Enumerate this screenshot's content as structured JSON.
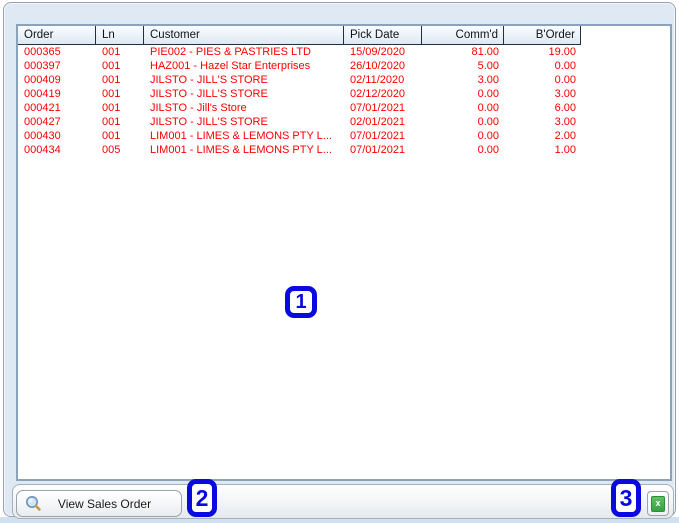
{
  "table": {
    "columns": [
      {
        "id": "order",
        "label": "Order"
      },
      {
        "id": "ln",
        "label": "Ln"
      },
      {
        "id": "customer",
        "label": "Customer"
      },
      {
        "id": "pickdate",
        "label": "Pick Date"
      },
      {
        "id": "commd",
        "label": "Comm'd"
      },
      {
        "id": "border",
        "label": "B'Order"
      }
    ],
    "rows": [
      [
        "000365",
        "001",
        "PIE002 - PIES & PASTRIES LTD",
        "15/09/2020",
        "81.00",
        "19.00"
      ],
      [
        "000397",
        "001",
        "HAZ001 - Hazel Star Enterprises",
        "26/10/2020",
        "5.00",
        "0.00"
      ],
      [
        "000409",
        "001",
        "JILSTO - JILL'S STORE",
        "02/11/2020",
        "3.00",
        "0.00"
      ],
      [
        "000419",
        "001",
        "JILSTO - JILL'S STORE",
        "02/12/2020",
        "0.00",
        "3.00"
      ],
      [
        "000421",
        "001",
        "JILSTO - Jill's Store",
        "07/01/2021",
        "0.00",
        "6.00"
      ],
      [
        "000427",
        "001",
        "JILSTO - JILL'S STORE",
        "02/01/2021",
        "0.00",
        "3.00"
      ],
      [
        "000430",
        "001",
        "LIM001 - LIMES & LEMONS PTY L...",
        "07/01/2021",
        "0.00",
        "2.00"
      ],
      [
        "000434",
        "005",
        "LIM001 - LIMES & LEMONS PTY L...",
        "07/01/2021",
        "0.00",
        "1.00"
      ]
    ],
    "row_text_color": "#ff0000"
  },
  "toolbar": {
    "view_sales_order_label": "View Sales Order"
  },
  "icons": {
    "view_button_icon": "magnifier-icon",
    "export_button_icon": "excel-export-icon"
  },
  "markers": [
    {
      "label": "1"
    },
    {
      "label": "2"
    },
    {
      "label": "3"
    }
  ],
  "colors": {
    "marker_blue": "#0a0ae0",
    "window_background": "#dfe9f4",
    "header_separator": "#1f3042",
    "table_border": "#8aa2ba"
  }
}
